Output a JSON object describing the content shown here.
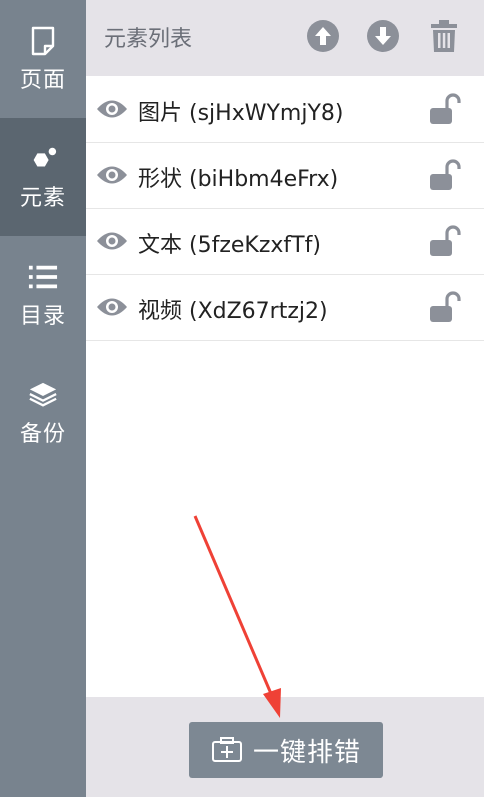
{
  "sidebar": {
    "items": [
      {
        "label": "页面",
        "icon": "page-icon",
        "active": false
      },
      {
        "label": "元素",
        "icon": "elements-icon",
        "active": true
      },
      {
        "label": "目录",
        "icon": "list-icon",
        "active": false
      },
      {
        "label": "备份",
        "icon": "layers-icon",
        "active": false
      }
    ]
  },
  "header": {
    "title": "元素列表",
    "buttons": [
      "move-up-icon",
      "move-down-icon",
      "trash-icon"
    ]
  },
  "elements": [
    {
      "name": "图片 (sjHxWYmjY8)",
      "visible": true,
      "locked": false
    },
    {
      "name": "形状 (biHbm4eFrx)",
      "visible": true,
      "locked": false
    },
    {
      "name": "文本 (5fzeKzxfTf)",
      "visible": true,
      "locked": false
    },
    {
      "name": "视频 (XdZ67rtzj2)",
      "visible": true,
      "locked": false
    }
  ],
  "footer": {
    "sort_button_label": "一键排错",
    "sort_button_icon": "add-box-icon"
  },
  "colors": {
    "sidebar_bg": "#78838e",
    "sidebar_active": "#5b6670",
    "header_bg": "#e5e3e8",
    "icon_gray": "#8c9099",
    "arrow_red": "#ef4136"
  }
}
